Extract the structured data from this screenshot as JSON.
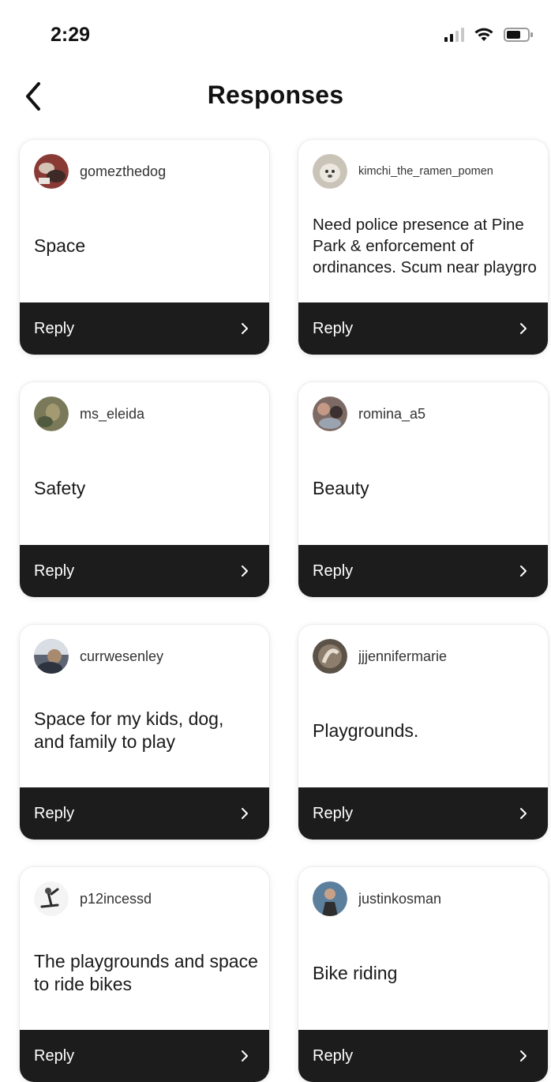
{
  "status_bar": {
    "time": "2:29",
    "icons": [
      "signal-icon",
      "wifi-icon",
      "battery-icon"
    ]
  },
  "header": {
    "title": "Responses",
    "back_icon": "chevron-left-icon"
  },
  "colors": {
    "reply_bar": "#1c1c1c",
    "card_background": "#ffffff",
    "text": "#1a1a1a"
  },
  "responses": [
    {
      "username": "gomezthedog",
      "text": "Space",
      "reply_label": "Reply",
      "avatar_color": "#8a3a34"
    },
    {
      "username": "kimchi_the_ramen_pomen",
      "text": "Need police presence at Pine Park & enforcement of ordinances. Scum near playgro",
      "reply_label": "Reply",
      "avatar_color": "#c9c3b8"
    },
    {
      "username": "ms_eleida",
      "text": "Safety",
      "reply_label": "Reply",
      "avatar_color": "#7a7a5a"
    },
    {
      "username": "romina_a5",
      "text": "Beauty",
      "reply_label": "Reply",
      "avatar_color": "#7d6a64"
    },
    {
      "username": "currwesenley",
      "text": "Space for my kids, dog, and family to play",
      "reply_label": "Reply",
      "avatar_color": "#5d6472"
    },
    {
      "username": "jjjennifermarie",
      "text": "Playgrounds.",
      "reply_label": "Reply",
      "avatar_color": "#5b5248"
    },
    {
      "username": "p12incessd",
      "text": "The playgrounds and space to ride bikes",
      "reply_label": "Reply",
      "avatar_color": "#4b4b4b"
    },
    {
      "username": "justinkosman",
      "text": "Bike riding",
      "reply_label": "Reply",
      "avatar_color": "#5c7f9e"
    }
  ]
}
